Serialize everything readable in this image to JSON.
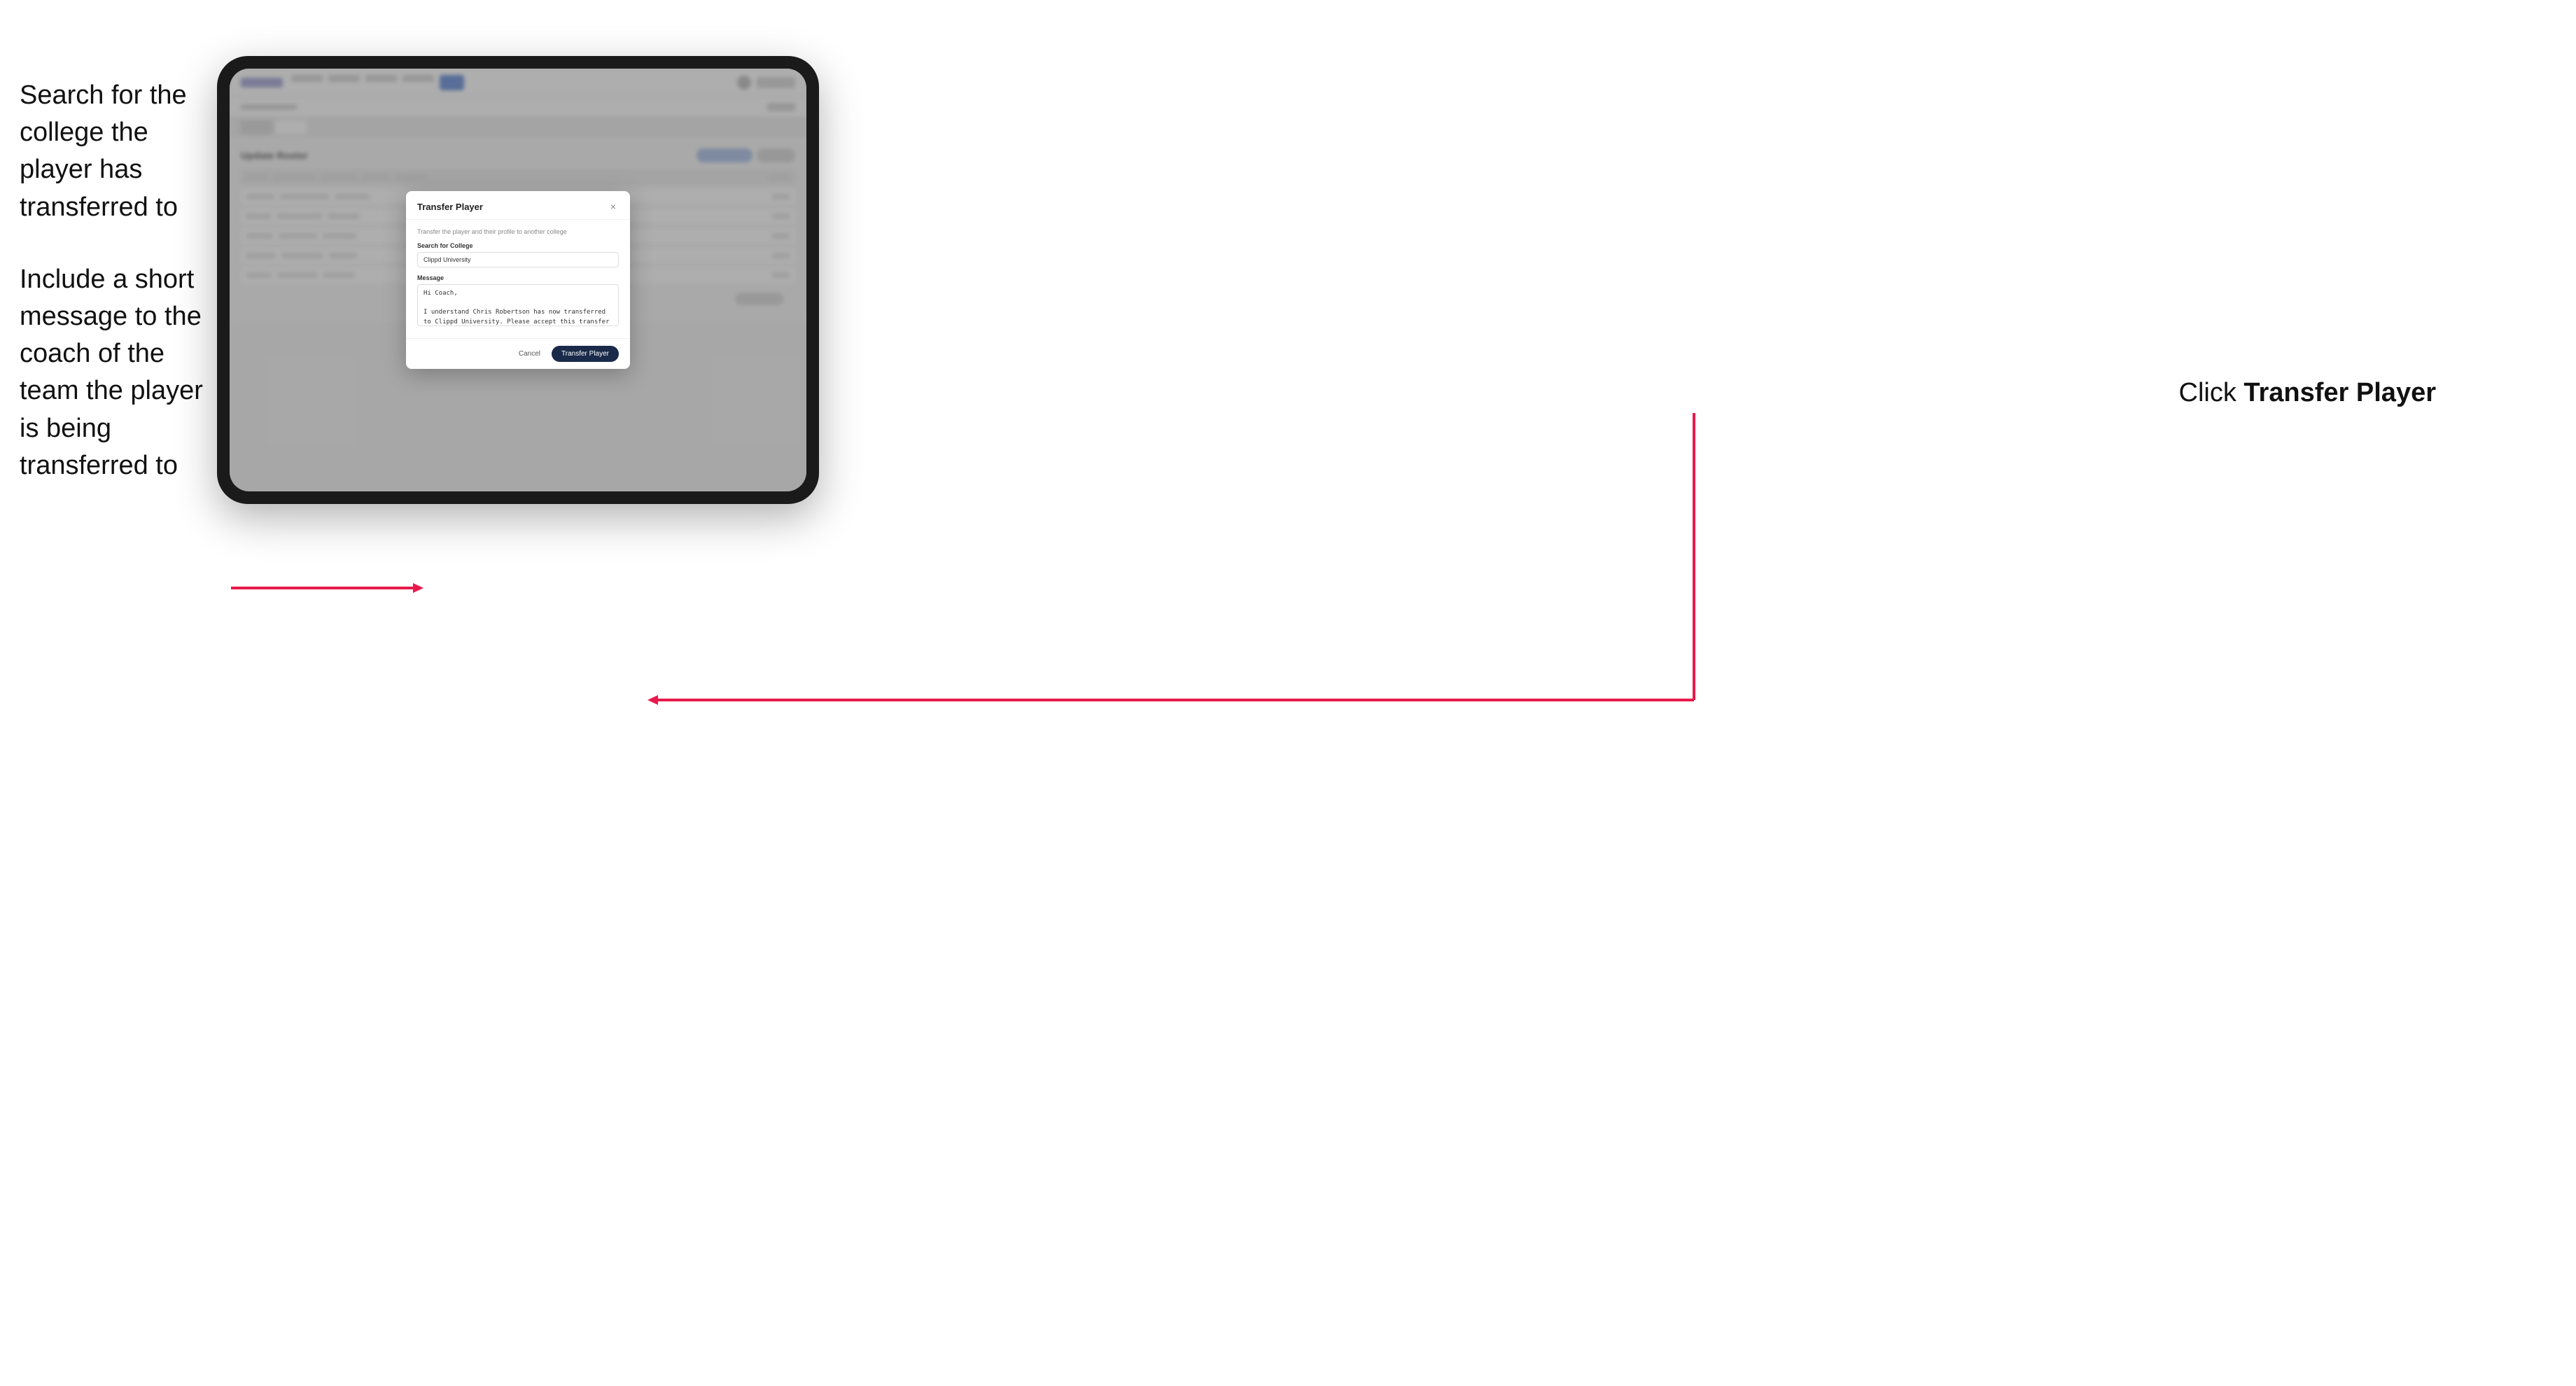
{
  "annotations": {
    "left_line1": "Search for the college the player has transferred to",
    "left_line2": "Include a short message to the coach of the team the player is being transferred to",
    "right_text_prefix": "Click ",
    "right_text_bold": "Transfer Player"
  },
  "modal": {
    "title": "Transfer Player",
    "description": "Transfer the player and their profile to another college",
    "search_label": "Search for College",
    "search_value": "Clippd University",
    "message_label": "Message",
    "message_value": "Hi Coach,\n\nI understand Chris Robertson has now transferred to Clippd University. Please accept this transfer request when you can.",
    "cancel_label": "Cancel",
    "transfer_label": "Transfer Player",
    "close_icon": "×"
  },
  "tablet": {
    "page_title": "Update Roster"
  }
}
